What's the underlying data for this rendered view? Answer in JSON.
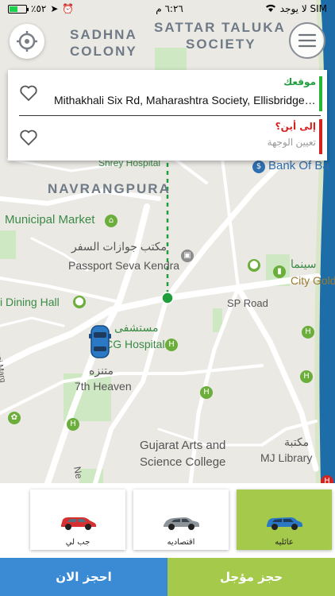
{
  "status_bar": {
    "carrier": "لا يوجد SIM",
    "time": "٦:٢٦ م",
    "battery": "٪٥٢",
    "battery_level": 0.52
  },
  "map": {
    "areas": [
      "SADHNA",
      "COLONY",
      "SATTAR TALUKA",
      "SOCIETY",
      "NAVRANGPURA"
    ],
    "pois": {
      "shrey": "Shrey Hospital",
      "bank": "Bank Of Ba",
      "municipal": "Municipal Market",
      "passport_ar": "مكتب جوازات السفر",
      "passport_en": "Passport Seva Kendra",
      "cinema_ar": "سينما",
      "cinema_en": "City Gold",
      "dining": "i Dining Hall",
      "sp_road": "SP Road",
      "hospital_ar": "مستشفى",
      "hospital_en": "HCG Hospitals",
      "park_ar": "متنزه",
      "park_en": "7th Heaven",
      "gujarat_1": "Gujarat Arts and",
      "gujarat_2": "Science College",
      "library_ar": "مكتبة",
      "library_en": "MJ Library",
      "desai": "Desai Marg",
      "ne": "Ne"
    }
  },
  "route": {
    "from_label": "موقعك",
    "from_value": "Mithakhali Six Rd, Maharashtra Society, Ellisbridge, Ahmedabad",
    "to_label": "إلى أين؟",
    "to_placeholder": "تعيين الوجهة"
  },
  "vehicles": [
    {
      "label": "جب لي",
      "color": "#d63030"
    },
    {
      "label": "اقتصاديه",
      "color": "#8d949a"
    },
    {
      "label": "عائليه",
      "color": "#2b78c4"
    }
  ],
  "selected_vehicle": 2,
  "actions": {
    "book_now": "احجز الان",
    "book_later": "حجز مؤجل"
  },
  "colors": {
    "accent_green": "#a5c94a",
    "accent_blue": "#3a8ad4",
    "route_dot": "#1f9e3b"
  }
}
